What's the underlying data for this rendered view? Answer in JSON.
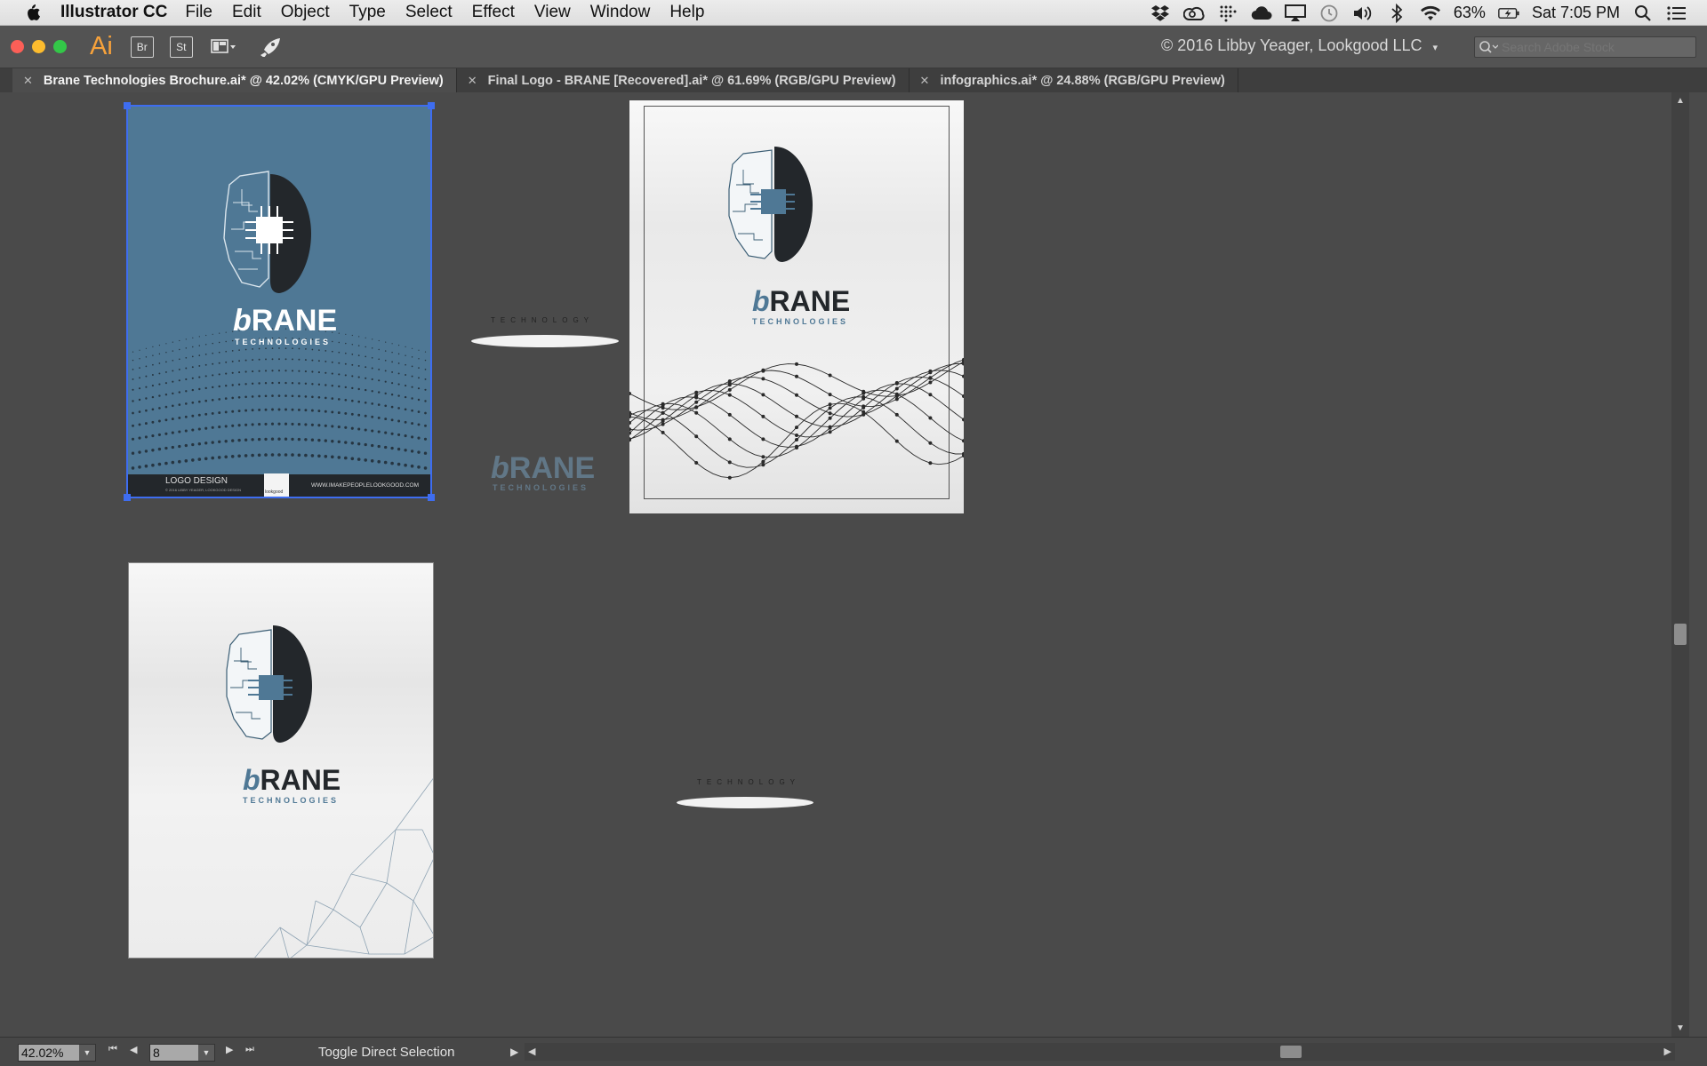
{
  "menubar": {
    "app_name": "Illustrator CC",
    "items": [
      "File",
      "Edit",
      "Object",
      "Type",
      "Select",
      "Effect",
      "View",
      "Window",
      "Help"
    ],
    "battery": "63%",
    "clock": "Sat 7:05 PM"
  },
  "appbar": {
    "logo": "Ai",
    "bridge_label": "Br",
    "stock_label": "St",
    "copyright": "© 2016 Libby Yeager, Lookgood LLC",
    "search_placeholder": "Search Adobe Stock"
  },
  "tabs": [
    {
      "label": "Brane Technologies Brochure.ai* @ 42.02% (CMYK/GPU Preview)",
      "active": true
    },
    {
      "label": "Final Logo - BRANE [Recovered].ai* @ 61.69% (RGB/GPU Preview)",
      "active": false
    },
    {
      "label": "infographics.ai* @ 24.88% (RGB/GPU Preview)",
      "active": false
    }
  ],
  "artwork": {
    "brand_b": "b",
    "brand_rest": "RANE",
    "brand_sub": "TECHNOLOGIES",
    "tagline": "TECHNOLOGY",
    "ab1_footer_left": "LOGO DESIGN",
    "ab1_footer_small": "© 2016 LIBBY YEAGER, LOOKGOOD DESIGN",
    "ab1_footer_center": "lookgood",
    "ab1_footer_right": "WWW.IMAKEPEOPLELOOKGOOD.COM"
  },
  "statusbar": {
    "zoom": "42.02%",
    "page": "8",
    "status_text": "Toggle Direct Selection"
  },
  "colors": {
    "accent_blue": "#4f7895",
    "brain_dark": "#23272b",
    "selection": "#3e6df0",
    "ai_orange": "#f7a23b"
  }
}
